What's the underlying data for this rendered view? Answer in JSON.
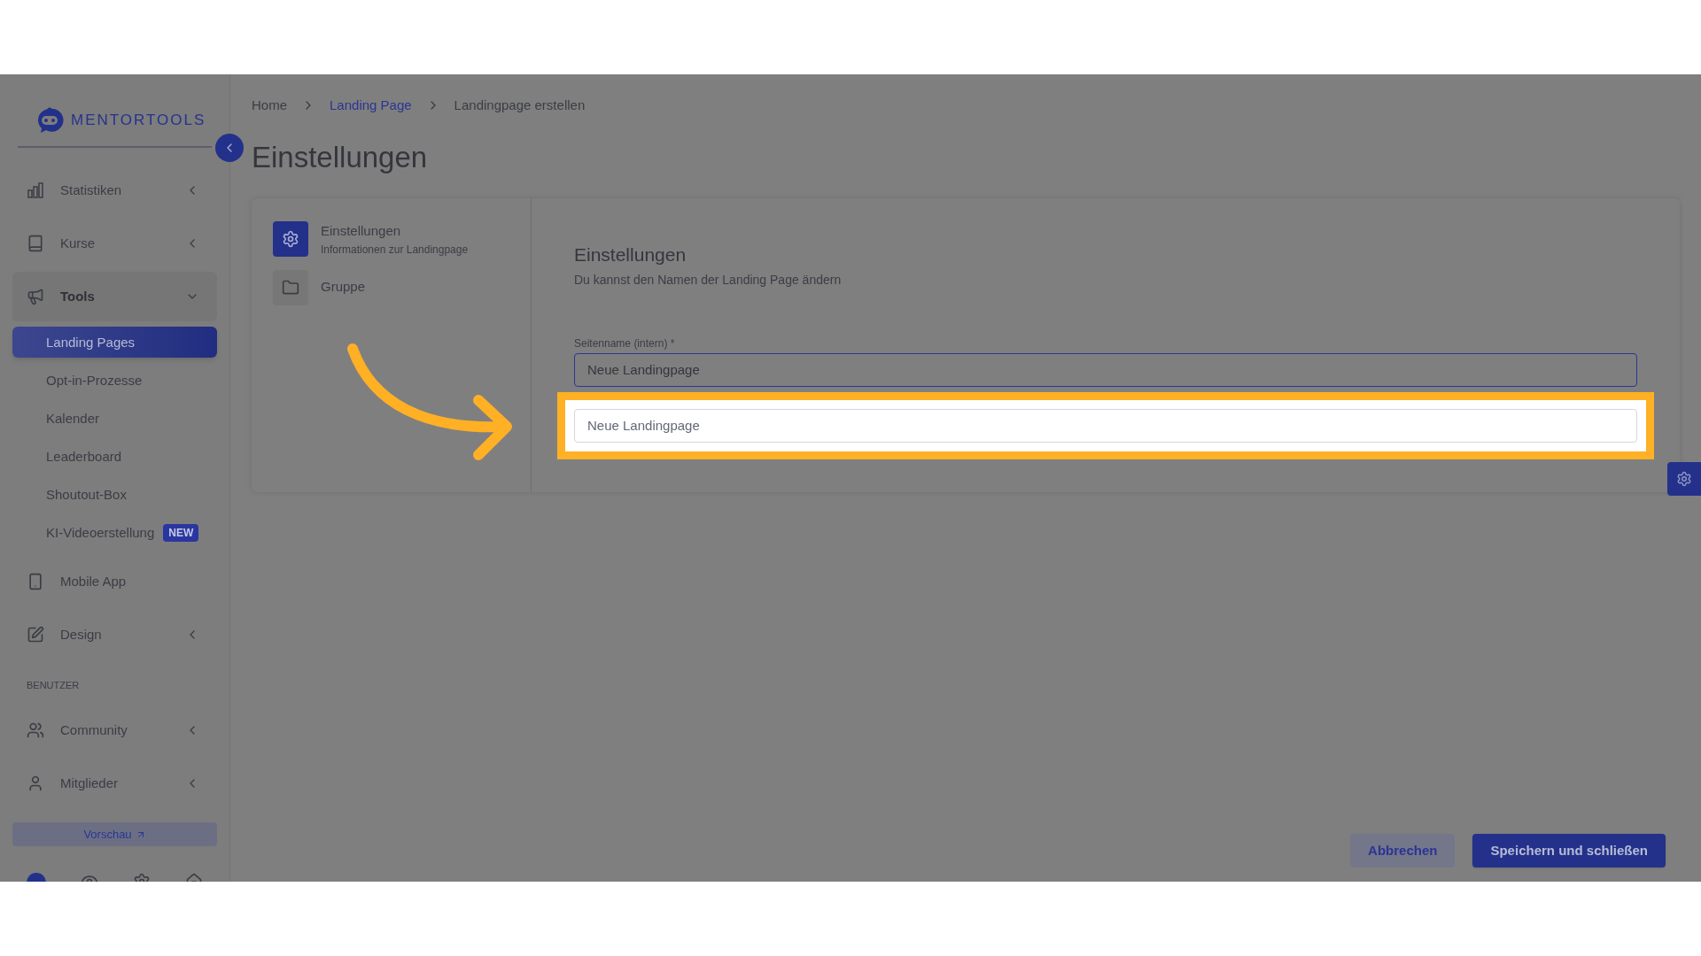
{
  "logo": {
    "text": "MENTORTOOLS"
  },
  "sidebar": {
    "items": [
      {
        "kind": "menu",
        "label": "Statistiken",
        "expanded": false
      },
      {
        "kind": "menu",
        "label": "Kurse",
        "expanded": false
      },
      {
        "kind": "menu",
        "label": "Tools",
        "expanded": true,
        "children": [
          {
            "label": "Landing Pages",
            "selected": true
          },
          {
            "label": "Opt-in-Prozesse",
            "selected": false
          },
          {
            "label": "Kalender",
            "selected": false
          },
          {
            "label": "Leaderboard",
            "selected": false
          },
          {
            "label": "Shoutout-Box",
            "selected": false
          },
          {
            "label": "KI-Videoerstellung",
            "selected": false,
            "badge": "NEW"
          }
        ]
      },
      {
        "kind": "link",
        "label": "Mobile App"
      },
      {
        "kind": "menu",
        "label": "Design",
        "expanded": false
      },
      {
        "kind": "section",
        "label": "BENUTZER"
      },
      {
        "kind": "menu",
        "label": "Community",
        "expanded": false
      },
      {
        "kind": "menu",
        "label": "Mitglieder",
        "expanded": false
      }
    ],
    "preview_button": "Vorschau"
  },
  "breadcrumb": [
    {
      "label": "Home",
      "kind": "plain"
    },
    {
      "label": "Landing Page",
      "kind": "link"
    },
    {
      "label": "Landingpage erstellen",
      "kind": "plain"
    }
  ],
  "page_title": "Einstellungen",
  "steps": [
    {
      "title": "Einstellungen",
      "subtitle": "Informationen zur Landingpage",
      "selected": true
    },
    {
      "title": "Gruppe",
      "selected": false
    }
  ],
  "form": {
    "title": "Einstellungen",
    "subtitle": "Du kannst den Namen der Landing Page ändern",
    "fields": [
      {
        "label": "Seitenname (intern) *",
        "value": "Neue Landingpage",
        "active": true,
        "highlighted": false
      },
      {
        "value": "Neue Landingpage",
        "active": false,
        "highlighted": true
      }
    ]
  },
  "buttons": [
    {
      "label": "Abbrechen",
      "kind": "secondary"
    },
    {
      "label": "Speichern und schließen",
      "kind": "primary"
    }
  ]
}
